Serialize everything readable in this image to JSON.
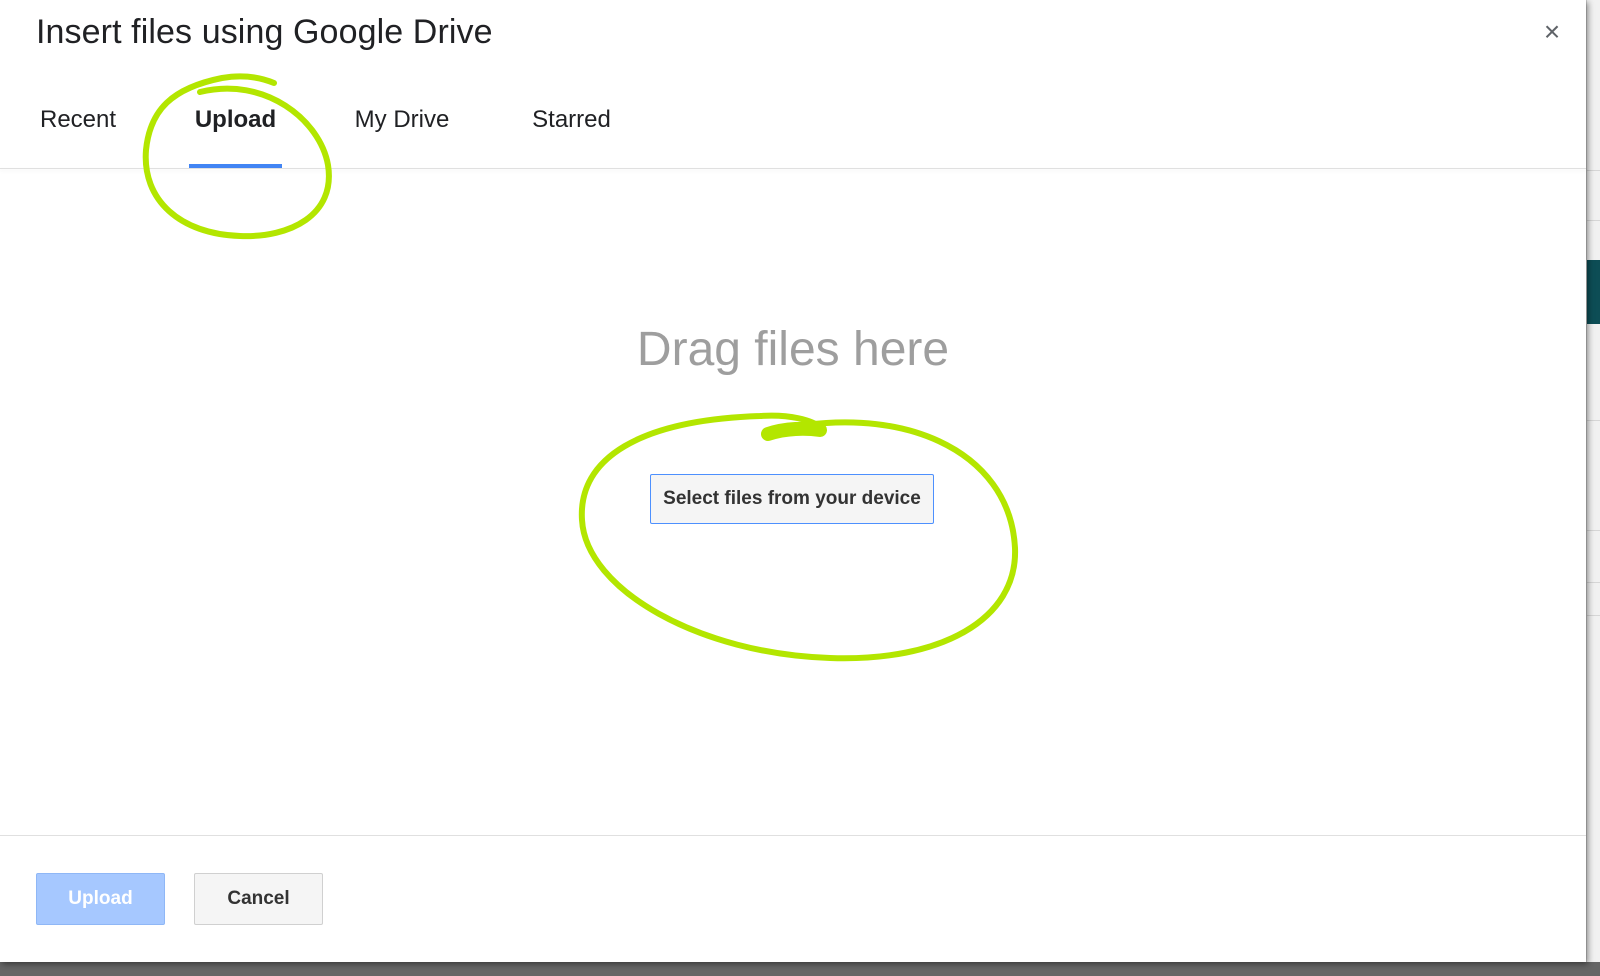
{
  "dialog": {
    "title": "Insert files using Google Drive",
    "close_glyph": "×"
  },
  "tabs": [
    {
      "label": "Recent",
      "active": false
    },
    {
      "label": "Upload",
      "active": true
    },
    {
      "label": "My Drive",
      "active": false
    },
    {
      "label": "Starred",
      "active": false
    }
  ],
  "upload_area": {
    "drop_text": "Drag files here",
    "select_button": "Select files from your device"
  },
  "footer": {
    "upload_button": "Upload",
    "cancel_button": "Cancel"
  },
  "colors": {
    "accent": "#4285f4",
    "annotation": "#b3e600",
    "upload_disabled": "#a6c8ff"
  }
}
